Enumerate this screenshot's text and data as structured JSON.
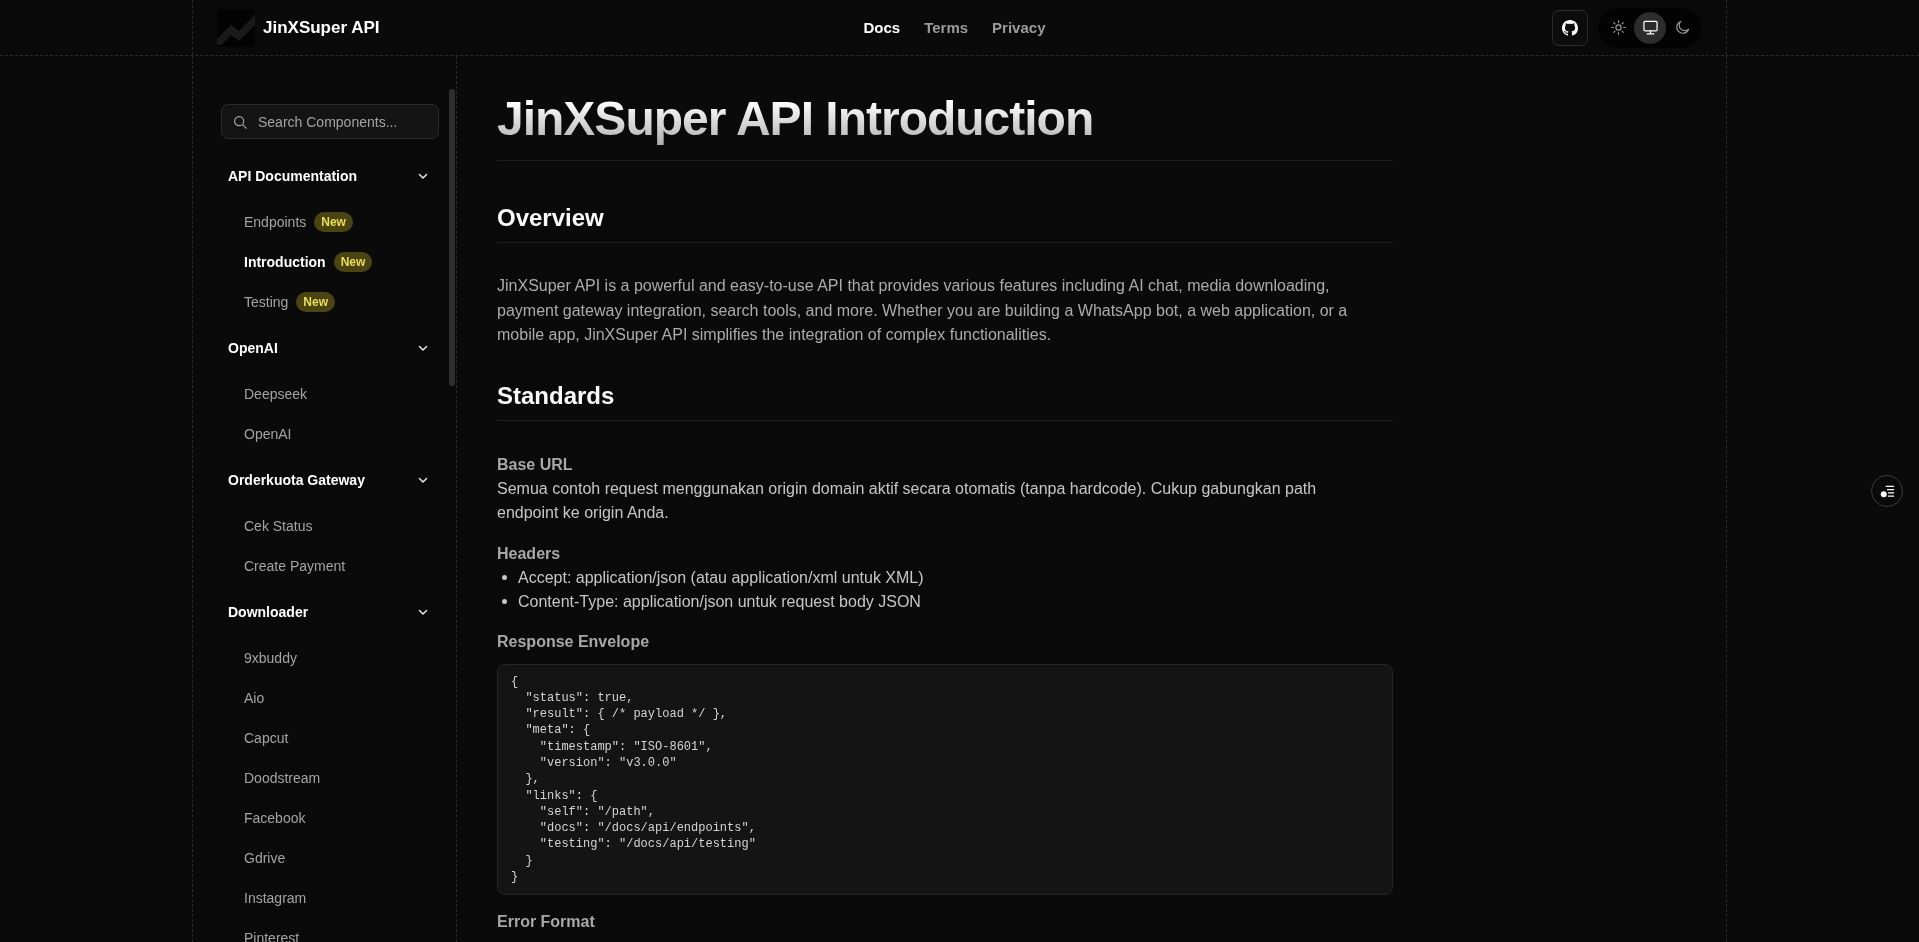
{
  "header": {
    "logo_text": "JinXSuper API",
    "nav": [
      {
        "label": "Docs",
        "selected": true
      },
      {
        "label": "Terms",
        "selected": false
      },
      {
        "label": "Privacy",
        "selected": false
      }
    ],
    "theme_options": [
      {
        "kind": "light",
        "selected": false
      },
      {
        "kind": "system",
        "selected": true
      },
      {
        "kind": "dark",
        "selected": false
      }
    ]
  },
  "sidebar": {
    "search": {
      "placeholder": "Search Components..."
    },
    "sections": [
      {
        "title": "API Documentation",
        "expanded": true,
        "items": [
          {
            "label": "Endpoints",
            "badge": "New",
            "selected": false
          },
          {
            "label": "Introduction",
            "badge": "New",
            "selected": true
          },
          {
            "label": "Testing",
            "badge": "New",
            "selected": false
          }
        ]
      },
      {
        "title": "OpenAI",
        "expanded": true,
        "items": [
          {
            "label": "Deepseek",
            "selected": false
          },
          {
            "label": "OpenAI",
            "selected": false
          }
        ]
      },
      {
        "title": "Orderkuota Gateway",
        "expanded": true,
        "items": [
          {
            "label": "Cek Status",
            "selected": false
          },
          {
            "label": "Create Payment",
            "selected": false
          }
        ]
      },
      {
        "title": "Downloader",
        "expanded": true,
        "items": [
          {
            "label": "9xbuddy",
            "selected": false
          },
          {
            "label": "Aio",
            "selected": false
          },
          {
            "label": "Capcut",
            "selected": false
          },
          {
            "label": "Doodstream",
            "selected": false
          },
          {
            "label": "Facebook",
            "selected": false
          },
          {
            "label": "Gdrive",
            "selected": false
          },
          {
            "label": "Instagram",
            "selected": false
          },
          {
            "label": "Pinterest",
            "selected": false
          }
        ]
      }
    ]
  },
  "content": {
    "title": "JinXSuper API Introduction",
    "sections": [
      {
        "heading": "Overview",
        "blocks": [
          {
            "kind": "paragraph",
            "text": "JinXSuper API is a powerful and easy-to-use API that provides various features including AI chat, media downloading, payment gateway integration, search tools, and more. Whether you are building a WhatsApp bot, a web application, or a mobile app, JinXSuper API simplifies the integration of complex functionalities."
          }
        ]
      },
      {
        "heading": "Standards",
        "blocks": [
          {
            "kind": "subheading",
            "text": "Base URL"
          },
          {
            "kind": "paragraph",
            "text": "Semua contoh request menggunakan origin domain aktif secara otomatis (tanpa hardcode). Cukup gabungkan path endpoint ke origin Anda."
          },
          {
            "kind": "subheading",
            "text": "Headers"
          },
          {
            "kind": "list",
            "items": [
              "Accept: application/json (atau application/xml untuk XML)",
              "Content-Type: application/json untuk request body JSON"
            ]
          },
          {
            "kind": "subheading",
            "text": "Response Envelope"
          },
          {
            "kind": "code",
            "text": "{\n  \"status\": true,\n  \"result\": { /* payload */ },\n  \"meta\": {\n    \"timestamp\": \"ISO-8601\",\n    \"version\": \"v3.0.0\"\n  },\n  \"links\": {\n    \"self\": \"/path\",\n    \"docs\": \"/docs/api/endpoints\",\n    \"testing\": \"/docs/api/testing\"\n  }\n}"
          },
          {
            "kind": "subheading",
            "text": "Error Format"
          }
        ]
      }
    ]
  }
}
